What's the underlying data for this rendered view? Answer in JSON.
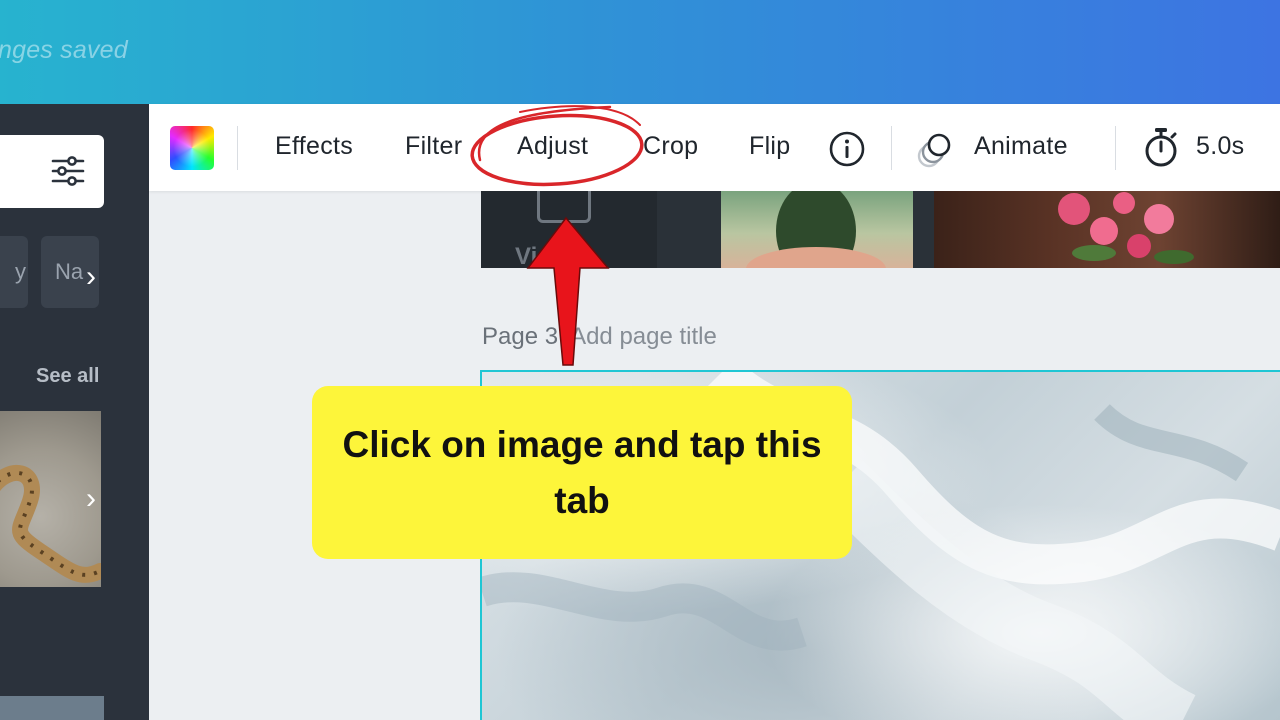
{
  "header": {
    "saved_status": "nges saved"
  },
  "sidebar": {
    "chips": [
      "y",
      "Na"
    ],
    "see_all": "See all"
  },
  "toolbar": {
    "effects": "Effects",
    "filter": "Filter",
    "adjust": "Adjust",
    "crop": "Crop",
    "flip": "Flip",
    "animate": "Animate",
    "duration": "5.0s"
  },
  "media_strip": {
    "videos_label": "Videos"
  },
  "page": {
    "number": "Page 3",
    "title_placeholder": "Add page title"
  },
  "callout": {
    "text": "Click on image and tap this tab"
  },
  "colors": {
    "callout_bg": "#fdf53a",
    "arrow": "#e8141b",
    "highlight_circle": "#d9262a",
    "selection": "#1fc6d4"
  },
  "icons": [
    "filter-sliders-icon",
    "chevron-right-icon",
    "color-palette-icon",
    "info-icon",
    "animate-icon",
    "timer-icon",
    "play-icon"
  ]
}
